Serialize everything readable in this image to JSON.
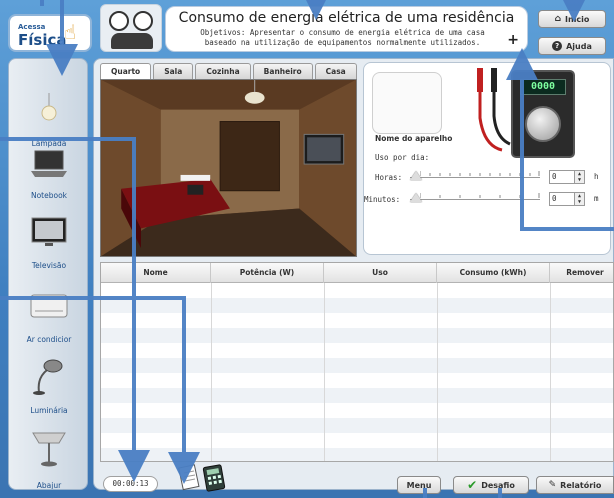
{
  "header": {
    "logo_line1": "Acessa",
    "logo_line2": "Física",
    "title": "Consumo de energia elétrica de uma residência",
    "objective_line1": "Objetivos: Apresentar o consumo de energia elétrica de uma casa",
    "objective_line2": "baseado na utilização de equipamentos normalmente utilizados.",
    "plus": "+",
    "btn_inicio": "Início",
    "btn_ajuda": "Ajuda"
  },
  "sidebar": {
    "items": [
      {
        "label": "Lâmpada",
        "icon": "lamp-icon"
      },
      {
        "label": "Notebook",
        "icon": "laptop-icon"
      },
      {
        "label": "Televisão",
        "icon": "tv-icon"
      },
      {
        "label": "Ar condicior",
        "icon": "air-conditioner-icon"
      },
      {
        "label": "Luminária",
        "icon": "desk-lamp-icon"
      },
      {
        "label": "Abajur",
        "icon": "table-lamp-icon"
      }
    ]
  },
  "tabs": [
    "Quarto",
    "Sala",
    "Cozinha",
    "Banheiro",
    "Casa"
  ],
  "active_tab": "Quarto",
  "device": {
    "name_label": "Nome do aparelho",
    "uso_label": "Uso por dia:",
    "horas_label": "Horas:",
    "minutos_label": "Minutos:",
    "horas_value": "0",
    "minutos_value": "0",
    "horas_unit": "h",
    "minutos_unit": "m",
    "meter_display": "0000"
  },
  "table": {
    "headers": [
      "Nome",
      "Potência (W)",
      "Uso",
      "Consumo (kWh)",
      "Remover"
    ],
    "rows": []
  },
  "footer": {
    "timer": "00:00:13",
    "btn_menu": "Menu",
    "btn_desafio": "Desafio",
    "btn_relatorio": "Relatório"
  },
  "colors": {
    "background": "#4d8bc9",
    "arrow": "#4a7fc4",
    "meter_digits": "#7dff9f"
  }
}
